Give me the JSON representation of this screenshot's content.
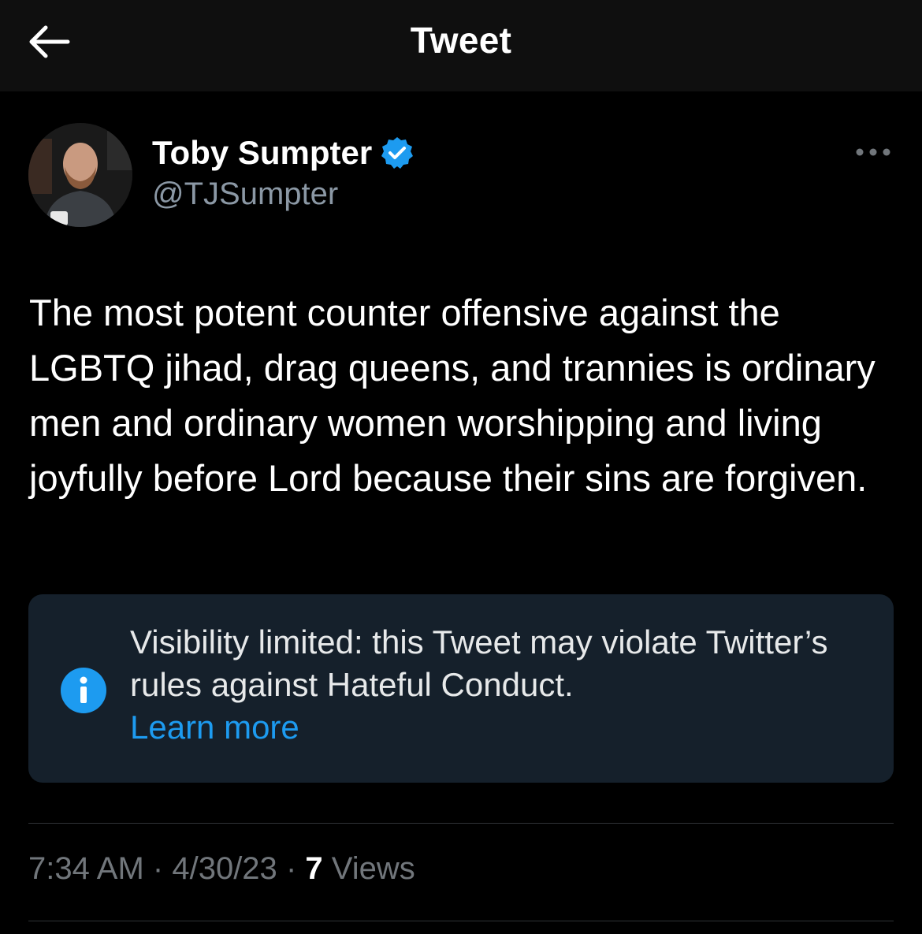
{
  "header": {
    "title": "Tweet",
    "back_icon": "arrow-left-icon"
  },
  "author": {
    "display_name": "Toby Sumpter",
    "handle": "@TJSumpter",
    "verified_icon": "verified-badge-icon",
    "more_icon": "more-horizontal-icon"
  },
  "tweet": {
    "text": "The most potent counter offensive against the LGBTQ jihad, drag queens, and trannies is ordinary men and ordinary women worshipping and living joyfully before Lord because their sins are forgiven."
  },
  "notice": {
    "icon": "info-icon",
    "message": "Visibility limited: this Tweet may violate Twitter’s rules against Hateful Conduct.",
    "link_label": "Learn more"
  },
  "meta": {
    "time": "7:34 AM",
    "date": "4/30/23",
    "separator": "·",
    "views_count": "7",
    "views_label": "Views"
  },
  "colors": {
    "background": "#000000",
    "header_bg": "#0f0f0f",
    "notice_bg": "#15202b",
    "accent": "#1d9bf0",
    "secondary_text": "#71767b"
  }
}
